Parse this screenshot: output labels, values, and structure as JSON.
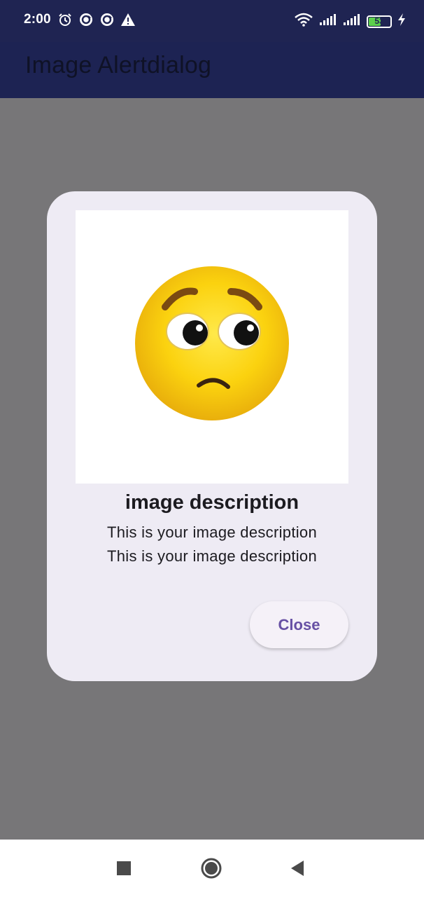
{
  "status_bar": {
    "time": "2:00",
    "battery": "53",
    "left_icons": [
      "alarm-icon",
      "sync-icon",
      "sync-icon",
      "warning-icon"
    ],
    "right_icons": [
      "wifi-icon",
      "signal-icon",
      "signal-icon",
      "battery-icon",
      "charging-icon"
    ]
  },
  "app_bar": {
    "title": "Image Alertdialog"
  },
  "dialog": {
    "image": "worried-face-emoji",
    "title": "image description",
    "lines": [
      "This is your image description",
      "This is your image description"
    ],
    "close_label": "Close"
  },
  "nav_bar": {
    "buttons": [
      "recents-square-icon",
      "home-circle-icon",
      "back-triangle-icon"
    ]
  },
  "colors": {
    "app_bar": "#1d2353",
    "scrim": "#777678",
    "dialog_bg": "#eeebf4",
    "accent": "#6750a4"
  }
}
